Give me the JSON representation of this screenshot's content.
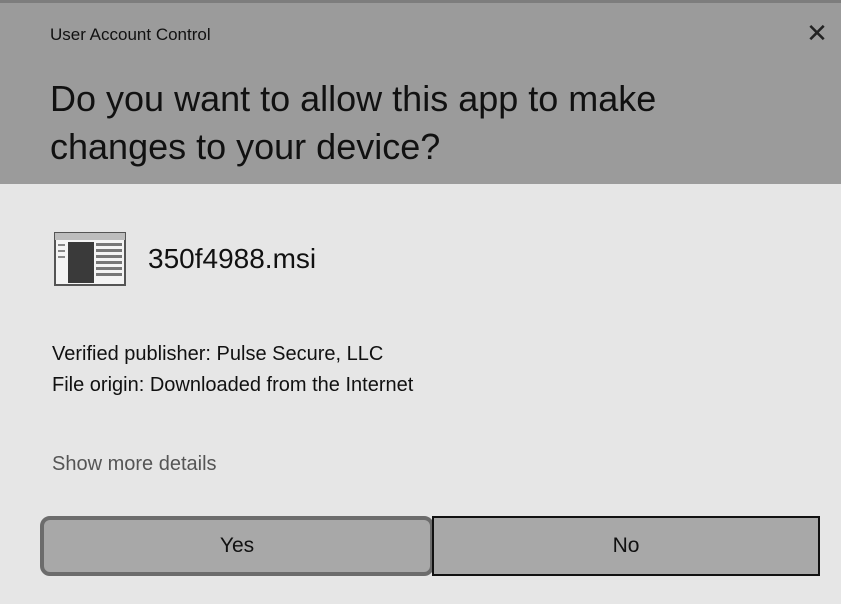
{
  "window": {
    "title": "User Account Control",
    "close_glyph": "✕"
  },
  "prompt": {
    "question": "Do you want to allow this app to make changes to your device?"
  },
  "file": {
    "icon": "installer-window-icon",
    "name": "350f4988.msi"
  },
  "details": {
    "publisher": "Verified publisher: Pulse Secure, LLC",
    "origin": "File origin: Downloaded from the Internet",
    "more_link": "Show more details"
  },
  "buttons": {
    "yes": "Yes",
    "no": "No"
  },
  "colors": {
    "header_bg": "#9b9b9b",
    "body_bg": "#e6e6e6",
    "button_bg": "#a8a8a8"
  }
}
